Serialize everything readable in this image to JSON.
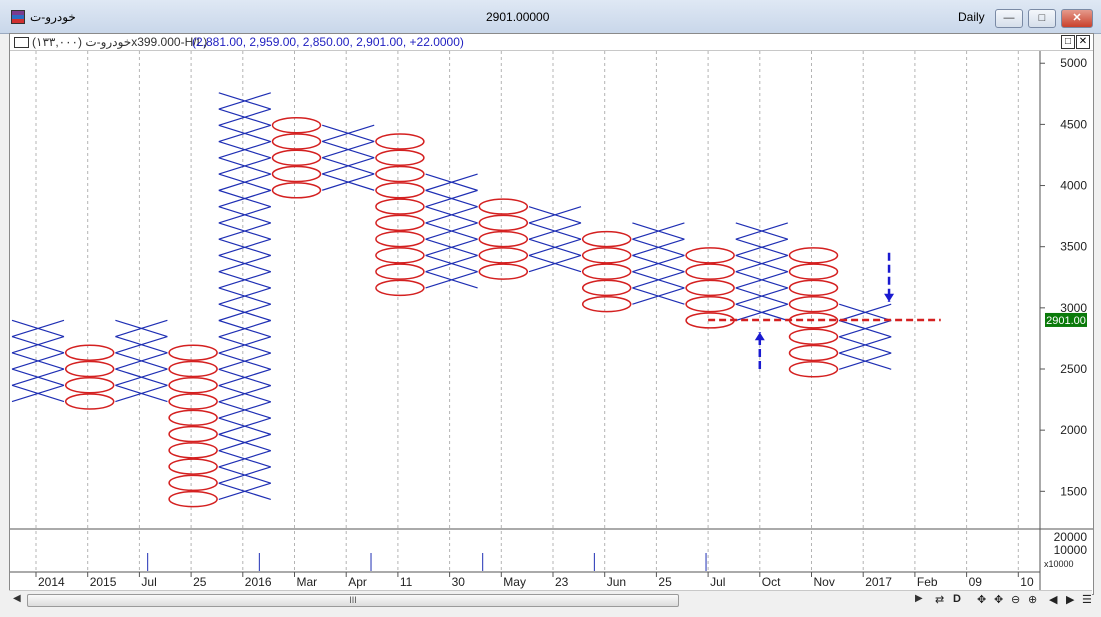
{
  "window": {
    "title_left": "خودرو-ت",
    "title_center": "2901.00000",
    "timeframe": "Daily",
    "buttons": {
      "minimize": "—",
      "maximize": "□",
      "close": "✕"
    }
  },
  "legend": {
    "symbol_text": "خودرو-ت (۱۳۳,۰۰۰)x399.000-H/L)",
    "values_text": "(2,881.00, 2,959.00, 2,850.00, 2,901.00, +22.0000)"
  },
  "chart_data": {
    "type": "point-and-figure",
    "box_size": 133,
    "last_price": 2901,
    "last_price_label": "2901.00",
    "colors": {
      "x": "#1f2fb4",
      "o": "#d42020",
      "grid": "#b4b4b4",
      "annotation": "#1a1ad0",
      "line": "#d42020"
    },
    "columns": [
      {
        "type": "X",
        "from": 2300,
        "to": 2766
      },
      {
        "type": "O",
        "from": 2633,
        "to": 2234
      },
      {
        "type": "X",
        "from": 2300,
        "to": 2766
      },
      {
        "type": "O",
        "from": 2633,
        "to": 1436
      },
      {
        "type": "X",
        "from": 1500,
        "to": 4626
      },
      {
        "type": "O",
        "from": 4493,
        "to": 3961
      },
      {
        "type": "X",
        "from": 4028,
        "to": 4493
      },
      {
        "type": "O",
        "from": 4360,
        "to": 3163
      },
      {
        "type": "X",
        "from": 3229,
        "to": 3961
      },
      {
        "type": "O",
        "from": 3828,
        "to": 3296
      },
      {
        "type": "X",
        "from": 3362,
        "to": 3695
      },
      {
        "type": "O",
        "from": 3562,
        "to": 3030
      },
      {
        "type": "X",
        "from": 3096,
        "to": 3562
      },
      {
        "type": "O",
        "from": 3429,
        "to": 2897
      },
      {
        "type": "X",
        "from": 2963,
        "to": 3562
      },
      {
        "type": "O",
        "from": 3429,
        "to": 2498
      },
      {
        "type": "X",
        "from": 2564,
        "to": 2897
      }
    ],
    "y_ticks": [
      5000,
      4500,
      4000,
      3500,
      3000,
      2500,
      2000,
      1500
    ],
    "y_range": [
      1200,
      5100
    ],
    "lower_pane_ticks": [
      "20000",
      "10000"
    ],
    "lower_pane_unit": "x10000",
    "x_labels": [
      "2014",
      "2015",
      "Jul",
      "25",
      "2016",
      "Mar",
      "Apr",
      "11",
      "30",
      "May",
      "23",
      "Jun",
      "25",
      "Jul",
      "Oct",
      "Nov",
      "2017",
      "Feb",
      "09",
      "10"
    ],
    "annotations": [
      {
        "kind": "arrow-down",
        "column": 16.5,
        "from": 3450,
        "to": 3050
      },
      {
        "kind": "arrow-up",
        "column": 14,
        "from": 2500,
        "to": 2800
      }
    ],
    "hline": {
      "value": 2901,
      "from_column": 13,
      "to_column": 17.5
    }
  },
  "toolbar": {
    "scroll_grip": "III",
    "tools": [
      "⇄",
      "D",
      "✥",
      "✥",
      "⊖",
      "⊕",
      "◀",
      "▶",
      "☰"
    ]
  }
}
